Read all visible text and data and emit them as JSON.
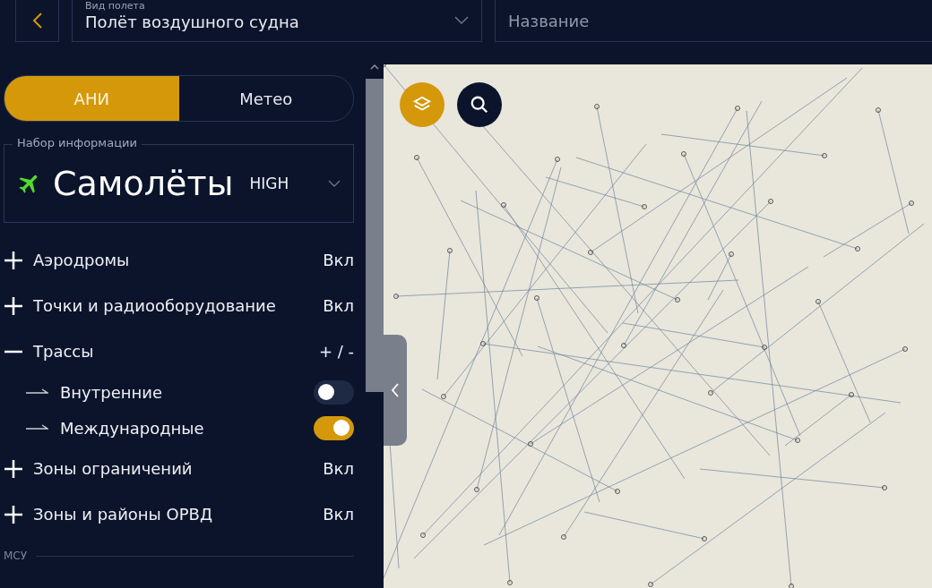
{
  "top_bar": {
    "flight_type": {
      "label": "Вид полета",
      "value": "Полёт воздушного судна"
    },
    "name_field": {
      "placeholder": "Название"
    }
  },
  "tabs": [
    {
      "label": "АНИ",
      "selected": true
    },
    {
      "label": "Метео",
      "selected": false
    }
  ],
  "info_set": {
    "label": "Набор информации",
    "value": "Самолёты",
    "level_text": "HIGH"
  },
  "layers": [
    {
      "label": "Аэродромы",
      "status": "Вкл",
      "expanded": false
    },
    {
      "label": "Точки и радиооборудование",
      "status": "Вкл",
      "expanded": false
    },
    {
      "label": "Трассы",
      "status": "+ / -",
      "expanded": true,
      "children": [
        {
          "label": "Внутренние",
          "on": false
        },
        {
          "label": "Международные",
          "on": true
        }
      ]
    },
    {
      "label": "Зоны ограничений",
      "status": "Вкл",
      "expanded": false
    },
    {
      "label": "Зоны и районы ОРВД",
      "status": "Вкл",
      "expanded": false
    }
  ],
  "section_label": "МСУ"
}
